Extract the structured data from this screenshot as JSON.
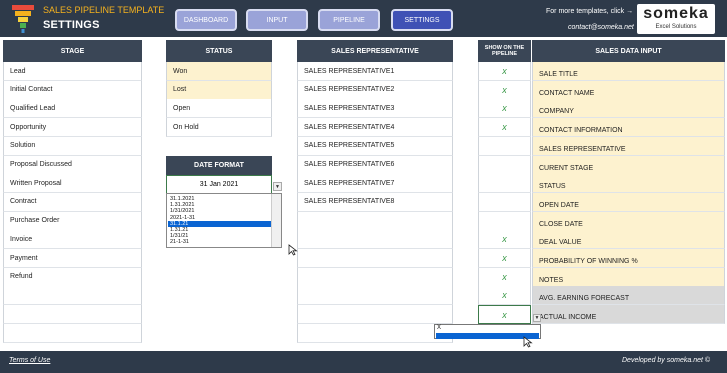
{
  "header": {
    "template_title": "SALES PIPELINE TEMPLATE",
    "page_title": "SETTINGS",
    "nav": [
      {
        "label": "DASHBOARD",
        "active": false
      },
      {
        "label": "INPUT",
        "active": false
      },
      {
        "label": "PIPELINE",
        "active": false
      },
      {
        "label": "SETTINGS",
        "active": true
      }
    ],
    "promo_line1": "For more templates, click →",
    "promo_line2": "contact@someka.net",
    "logo_name": "someka",
    "logo_sub": "Excel Solutions"
  },
  "stage": {
    "header": "STAGE",
    "items": [
      "Lead",
      "Initial Contact",
      "Qualified Lead",
      "Opportunity",
      "Solution",
      "Proposal Discussed",
      "Written Proposal",
      "Contract",
      "Purchase Order",
      "Invoice",
      "Payment",
      "Refund",
      "",
      "",
      ""
    ]
  },
  "status": {
    "header": "STATUS",
    "items": [
      "Won",
      "Lost",
      "Open",
      "On Hold"
    ]
  },
  "date_format": {
    "header": "DATE FORMAT",
    "value": "31 Jan 2021",
    "options": [
      "31.1.2021",
      "1.31.2021",
      "1/31/2021",
      "2021-1-31",
      "31.1.21",
      "1.31.21",
      "1/31/21",
      "21-1-31"
    ],
    "selected_index": 4
  },
  "sales_rep": {
    "header": "SALES REPRESENTATIVE",
    "items": [
      "SALES REPRESENTATIVE1",
      "SALES REPRESENTATIVE2",
      "SALES REPRESENTATIVE3",
      "SALES REPRESENTATIVE4",
      "SALES REPRESENTATIVE5",
      "SALES REPRESENTATIVE6",
      "SALES REPRESENTATIVE7",
      "SALES REPRESENTATIVE8",
      "",
      "",
      "",
      "",
      "",
      "",
      ""
    ]
  },
  "show_pipeline": {
    "header": "SHOW ON THE PIPELINE",
    "marks": [
      "x",
      "x",
      "x",
      "x",
      "",
      "",
      "",
      "",
      "",
      "x",
      "x",
      "x",
      "x",
      "x"
    ],
    "dropdown_option": "X"
  },
  "sales_input": {
    "header": "SALES DATA INPUT",
    "items": [
      {
        "label": "SALE TITLE",
        "editable": true
      },
      {
        "label": "CONTACT NAME",
        "editable": true
      },
      {
        "label": "COMPANY",
        "editable": true
      },
      {
        "label": "CONTACT INFORMATION",
        "editable": true
      },
      {
        "label": "SALES REPRESENTATIVE",
        "editable": true
      },
      {
        "label": "CURENT STAGE",
        "editable": true
      },
      {
        "label": "STATUS",
        "editable": true
      },
      {
        "label": "OPEN DATE",
        "editable": true
      },
      {
        "label": "CLOSE DATE",
        "editable": true
      },
      {
        "label": "DEAL VALUE",
        "editable": true
      },
      {
        "label": "PROBABILITY OF WINNING %",
        "editable": true
      },
      {
        "label": "NOTES",
        "editable": true
      },
      {
        "label": "AVG. EARNING FORECAST",
        "editable": false
      },
      {
        "label": "ACTUAL INCOME",
        "editable": false
      }
    ]
  },
  "footer": {
    "terms": "Terms of Use",
    "developer": "Developed by someka.net ©"
  },
  "colors": {
    "header_bg": "#2e3a4a",
    "column_header_bg": "#3a4656",
    "input_cell_bg": "#fdf2cf",
    "calc_cell_bg": "#d9d9d9",
    "nav_active": "#3f51b5",
    "nav_inactive": "#9aa3d8",
    "check_color": "#3c9a4a"
  }
}
